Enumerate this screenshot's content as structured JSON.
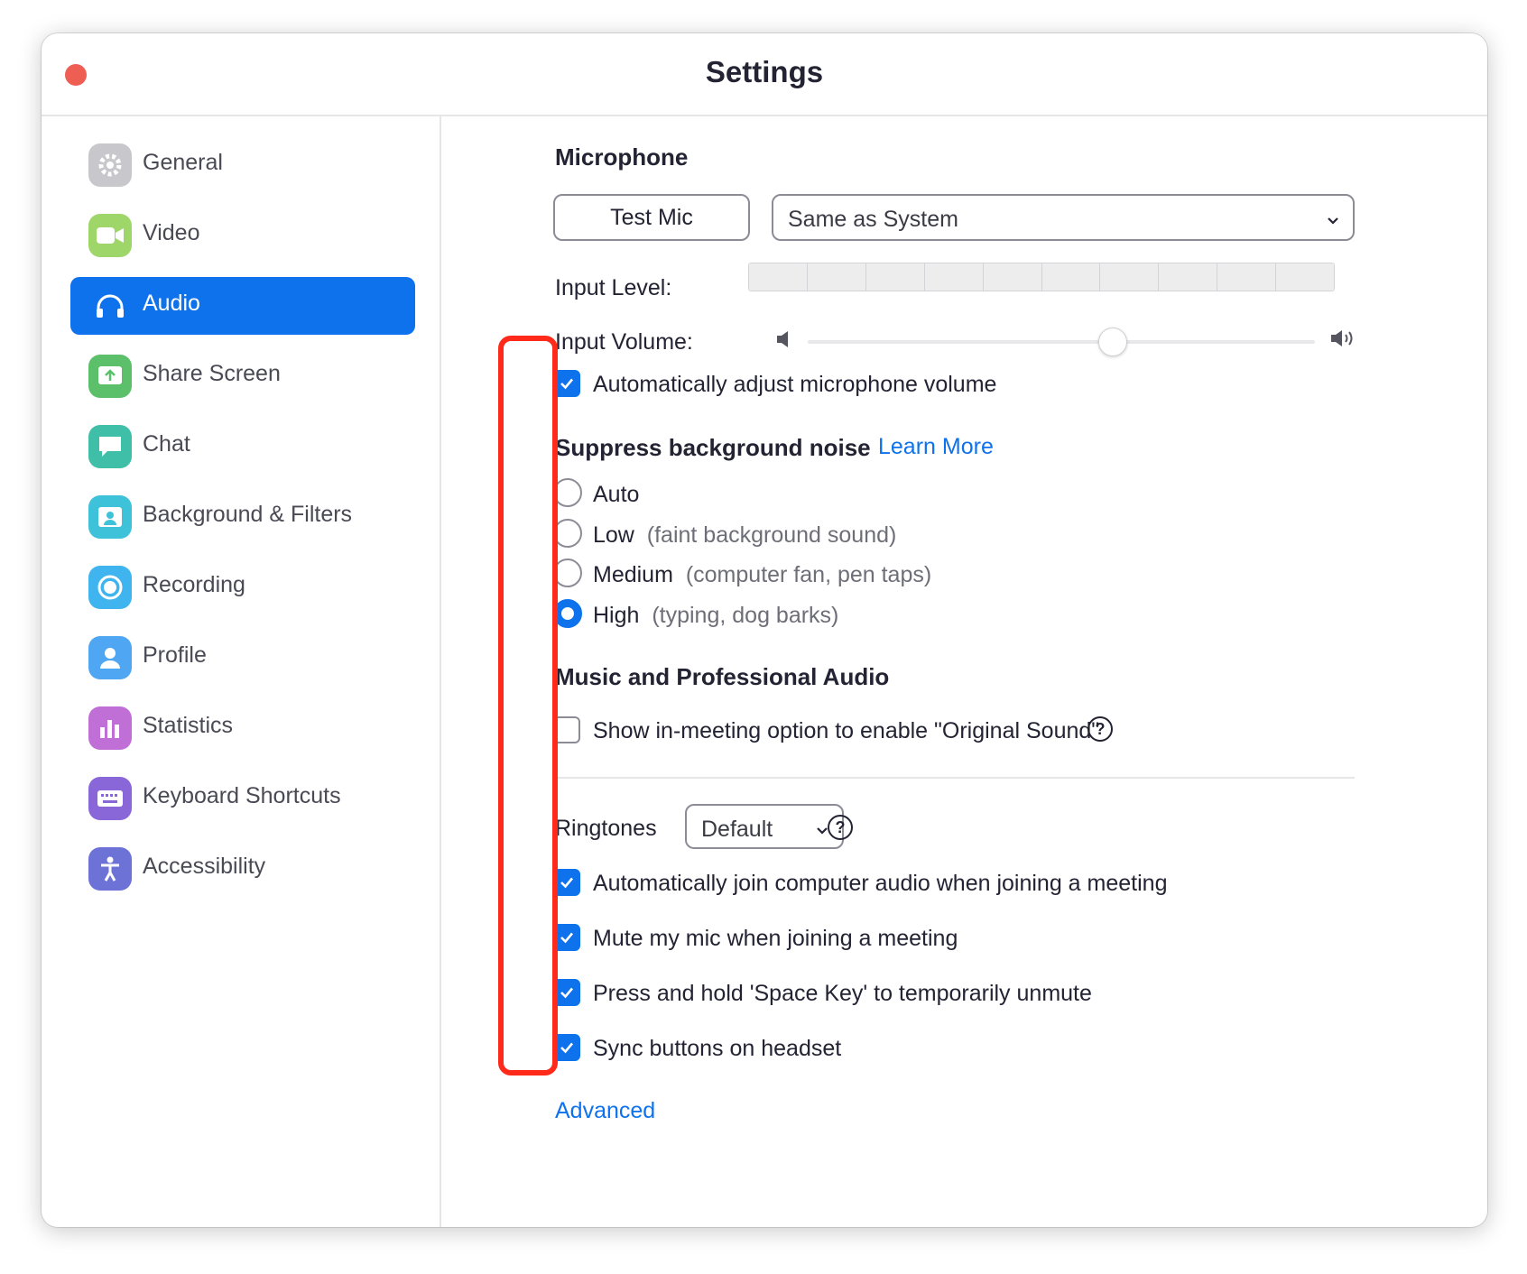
{
  "window": {
    "title": "Settings"
  },
  "sidebar": {
    "items": [
      {
        "label": "General",
        "icon": "gear-icon",
        "color": "#c7c7cc",
        "active": false
      },
      {
        "label": "Video",
        "icon": "video-camera-icon",
        "color": "#9fd66a",
        "active": false
      },
      {
        "label": "Audio",
        "icon": "headphones-icon",
        "color": "#0e72ed",
        "active": true
      },
      {
        "label": "Share Screen",
        "icon": "share-screen-icon",
        "color": "#5cc06a",
        "active": false
      },
      {
        "label": "Chat",
        "icon": "chat-bubble-icon",
        "color": "#3fbfa8",
        "active": false
      },
      {
        "label": "Background & Filters",
        "icon": "background-person-icon",
        "color": "#3ec2d9",
        "active": false
      },
      {
        "label": "Recording",
        "icon": "record-icon",
        "color": "#3fb4ef",
        "active": false
      },
      {
        "label": "Profile",
        "icon": "profile-person-icon",
        "color": "#4fa6f2",
        "active": false
      },
      {
        "label": "Statistics",
        "icon": "statistics-bars-icon",
        "color": "#c06fd6",
        "active": false
      },
      {
        "label": "Keyboard Shortcuts",
        "icon": "keyboard-icon",
        "color": "#8a67d8",
        "active": false
      },
      {
        "label": "Accessibility",
        "icon": "accessibility-icon",
        "color": "#6d73d6",
        "active": false
      }
    ]
  },
  "microphone": {
    "title": "Microphone",
    "test_button": "Test Mic",
    "device_select": "Same as System",
    "input_level_label": "Input Level:",
    "input_level_segments": 10,
    "input_level_value": 0,
    "input_volume_label": "Input Volume:",
    "input_volume_value": 0.6,
    "auto_adjust": {
      "label": "Automatically adjust microphone volume",
      "checked": true
    }
  },
  "noise": {
    "title": "Suppress background noise",
    "learn_more": "Learn More",
    "options": [
      {
        "label": "Auto",
        "hint": "",
        "checked": false
      },
      {
        "label": "Low",
        "hint": "(faint background sound)",
        "checked": false
      },
      {
        "label": "Medium",
        "hint": "(computer fan, pen taps)",
        "checked": false
      },
      {
        "label": "High",
        "hint": "(typing, dog barks)",
        "checked": true
      }
    ]
  },
  "music": {
    "title": "Music and Professional Audio",
    "original_sound": {
      "label": "Show in-meeting option to enable \"Original Sound\"",
      "checked": false
    },
    "help": "?"
  },
  "ringtones": {
    "label": "Ringtones",
    "select": "Default",
    "help": "?"
  },
  "options": [
    {
      "label": "Automatically join computer audio when joining a meeting",
      "checked": true
    },
    {
      "label": "Mute my mic when joining a meeting",
      "checked": true
    },
    {
      "label": "Press and hold 'Space Key' to temporarily unmute",
      "checked": true
    },
    {
      "label": "Sync buttons on headset",
      "checked": true
    }
  ],
  "advanced_link": "Advanced",
  "colors": {
    "accent": "#0e72ed",
    "highlight": "#ff2a1a",
    "close": "#ee5e52"
  }
}
